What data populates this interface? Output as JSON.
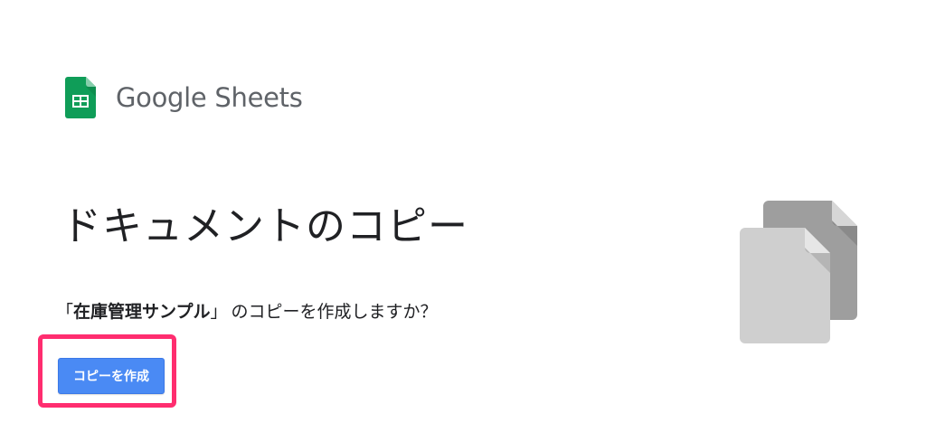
{
  "brand": {
    "name": "Google Sheets",
    "icon": "google-sheets-icon",
    "icon_color": "#0f9d58"
  },
  "dialog": {
    "title": "ドキュメントのコピー",
    "question_open_bracket": "「",
    "document_name": "在庫管理サンプル",
    "question_close_bracket": "」",
    "question_suffix": "のコピーを作成しますか？",
    "make_copy_label": "コピーを作成",
    "button_color": "#4a8af4",
    "highlight_color": "#ff2d6f"
  },
  "illustration": {
    "icon": "document-copy-icon"
  }
}
